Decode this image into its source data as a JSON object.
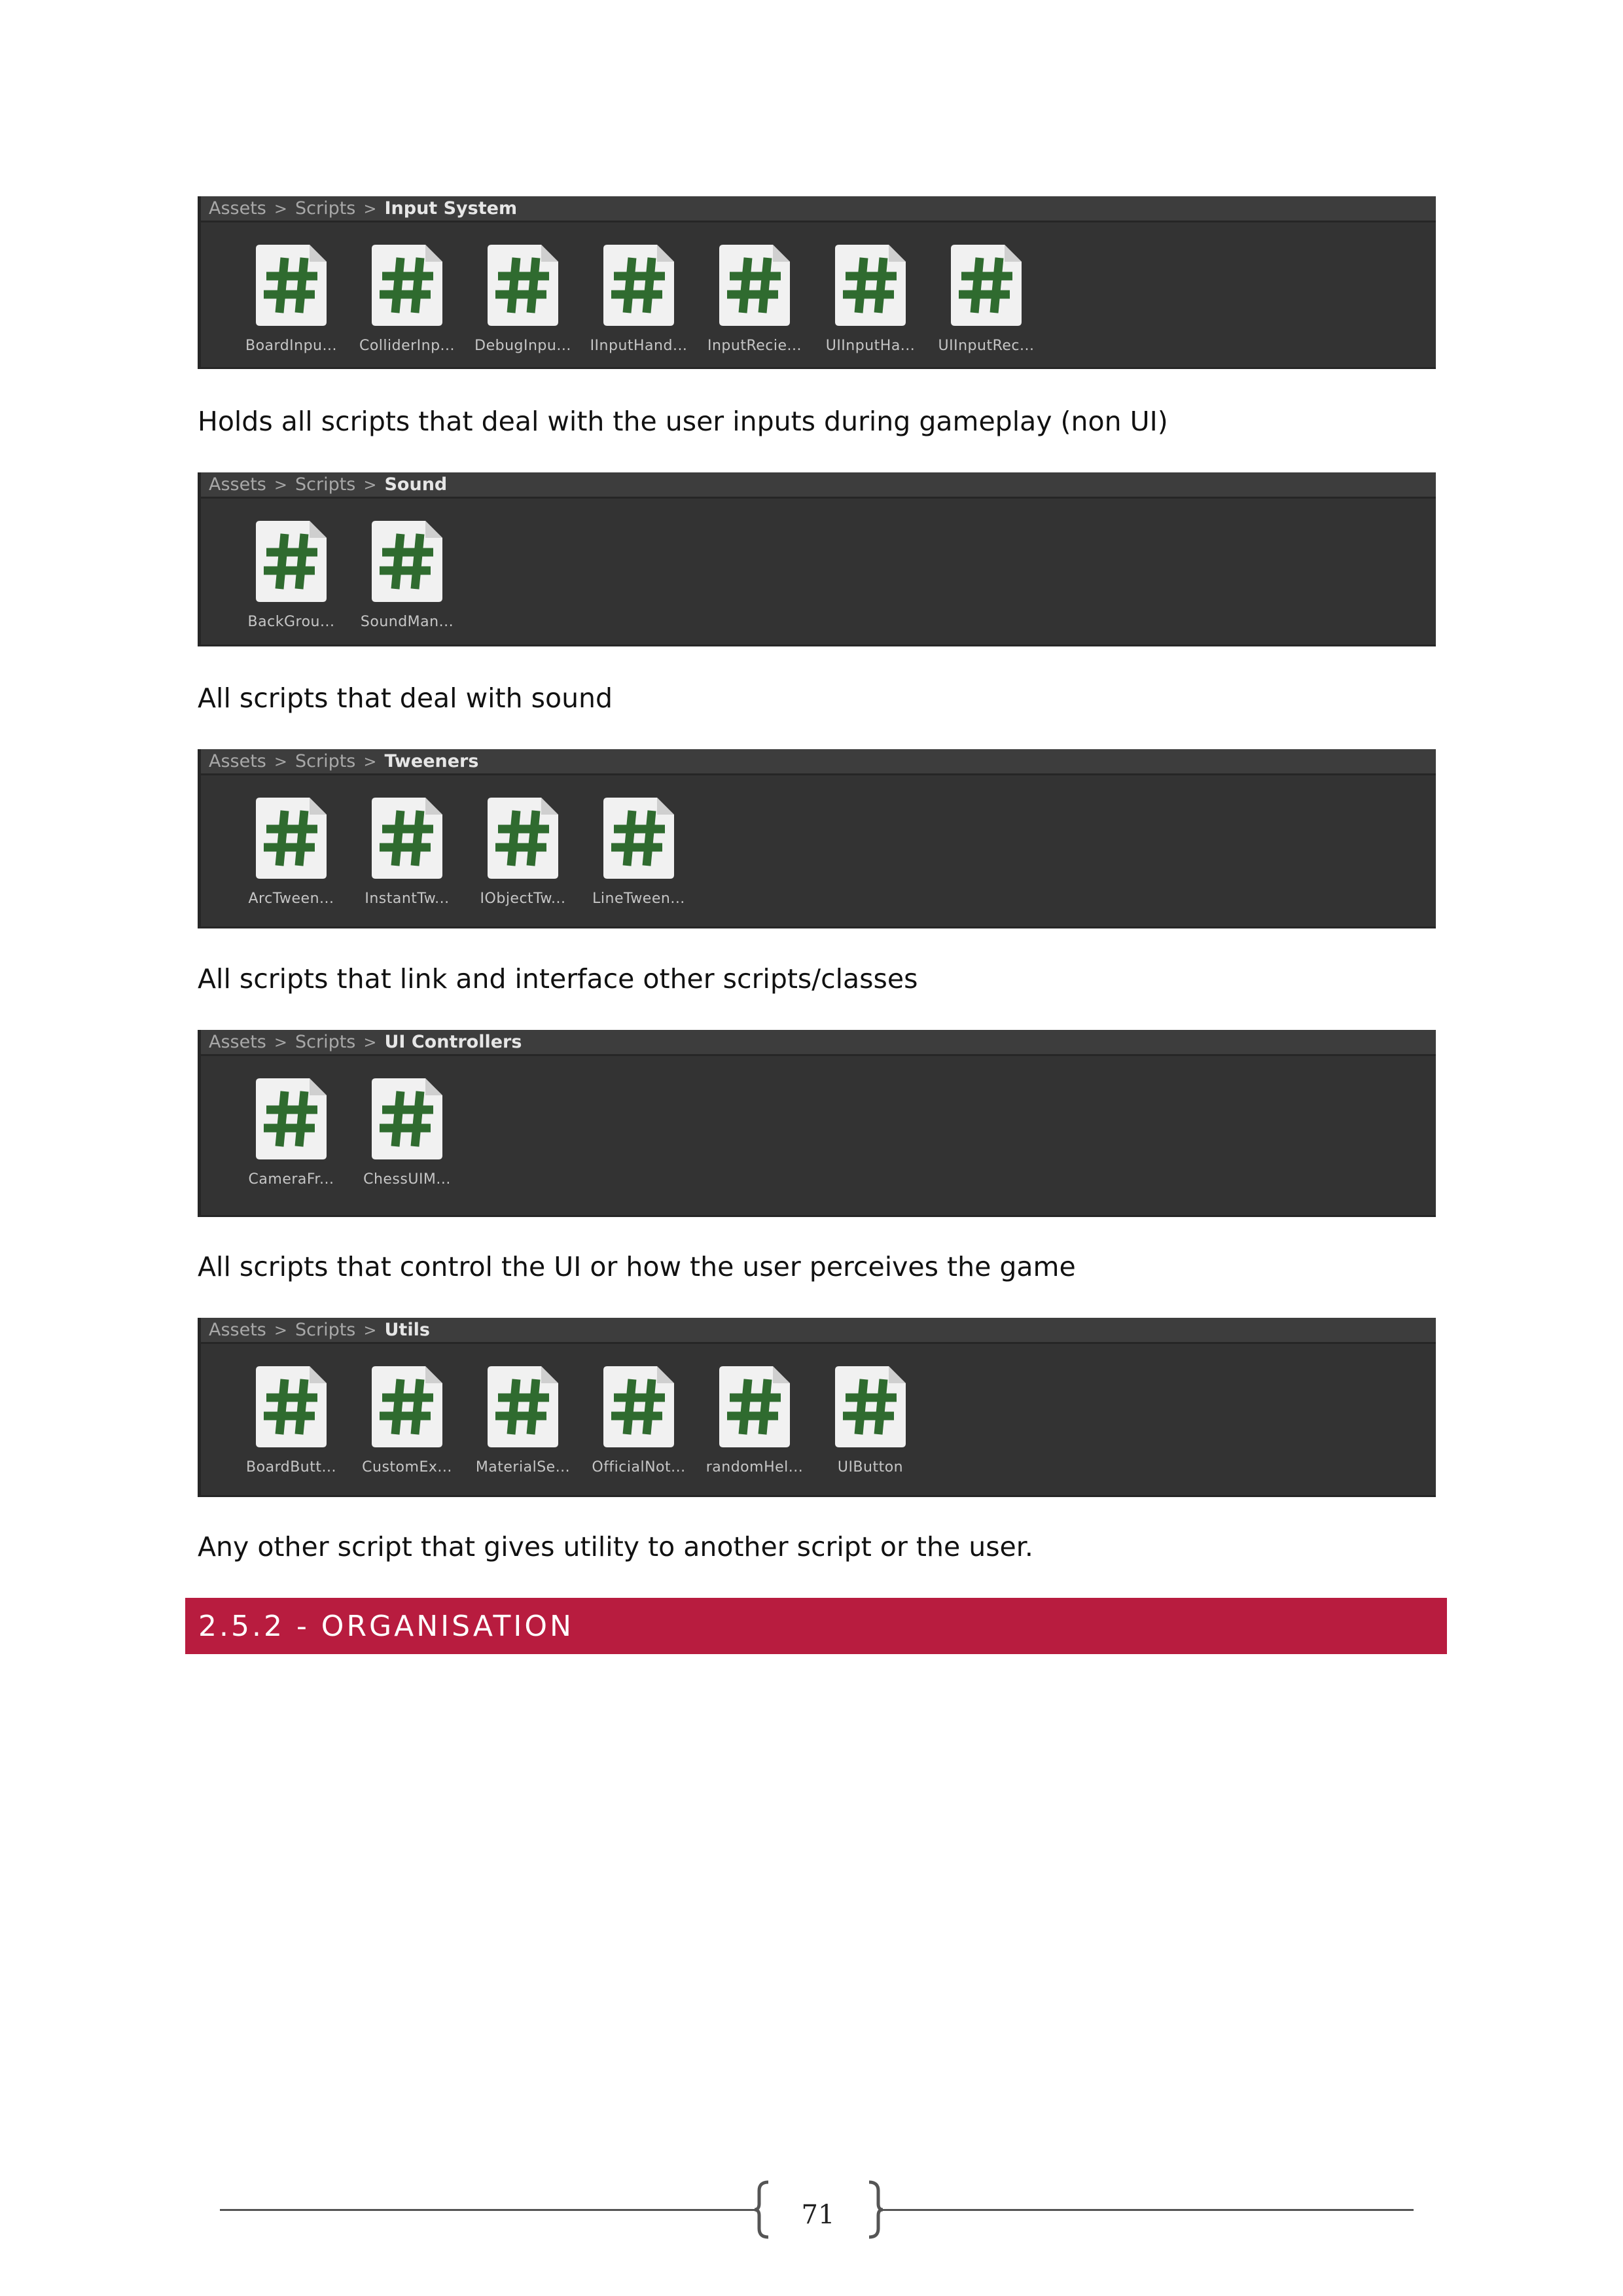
{
  "sections": [
    {
      "path": [
        "Assets",
        "Scripts",
        "Input System"
      ],
      "files": [
        "BoardInpu...",
        "ColliderInp...",
        "DebugInpu...",
        "IInputHand...",
        "InputRecie...",
        "UIInputHa...",
        "UIInputRec..."
      ],
      "caption": "Holds all scripts that deal with the user inputs during gameplay (non UI)"
    },
    {
      "path": [
        "Assets",
        "Scripts",
        "Sound"
      ],
      "files": [
        "BackGrou...",
        "SoundMan..."
      ],
      "caption": "All scripts that deal with sound"
    },
    {
      "path": [
        "Assets",
        "Scripts",
        "Tweeners"
      ],
      "files": [
        "ArcTween...",
        "InstantTw...",
        "IObjectTw...",
        "LineTween..."
      ],
      "caption": "All scripts that link and interface other scripts/classes"
    },
    {
      "path": [
        "Assets",
        "Scripts",
        "UI Controllers"
      ],
      "files": [
        "CameraFr...",
        "ChessUIM..."
      ],
      "caption": "All scripts that control the UI or how the user perceives the game"
    },
    {
      "path": [
        "Assets",
        "Scripts",
        "Utils"
      ],
      "files": [
        "BoardButt...",
        "CustomEx...",
        "MaterialSe...",
        "OfficialNot...",
        "randomHel...",
        "UIButton"
      ],
      "caption": "Any other script that gives utility to another script or the user."
    }
  ],
  "heading": "2.5.2 - ORGANISATION",
  "page_number": "71",
  "icon": "csharp-script-icon",
  "colors": {
    "hash": "#2f6b2f",
    "heading_bg": "#b81c3f",
    "panel_bg": "#333333"
  }
}
